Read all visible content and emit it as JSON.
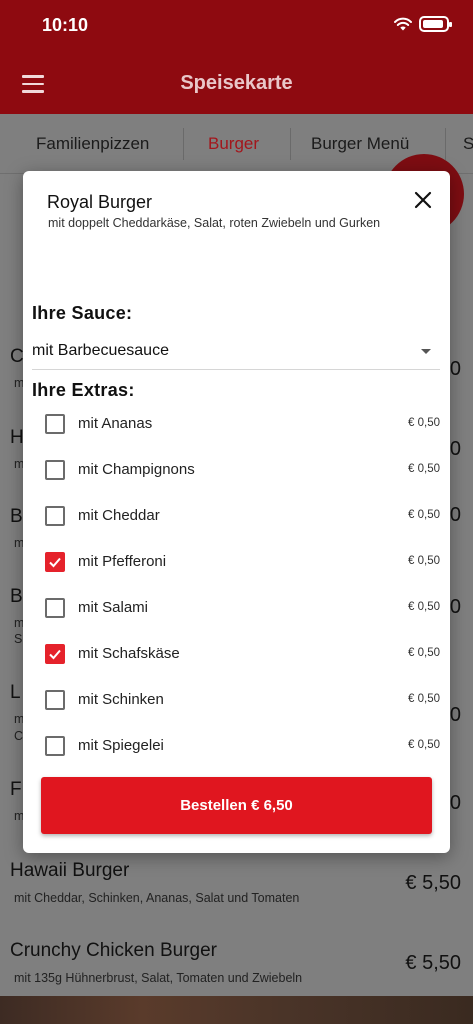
{
  "status_bar": {
    "time": "10:10"
  },
  "app_bar": {
    "title": "Speisekarte",
    "menu_icon": "hamburger-menu-icon"
  },
  "tabs": [
    {
      "label": "Familienpizzen",
      "active": false
    },
    {
      "label": "Burger",
      "active": true
    },
    {
      "label": "Burger Menü",
      "active": false
    },
    {
      "label": "S",
      "active": false
    }
  ],
  "background_list": [
    {
      "name": "C",
      "desc": "m",
      "price": "0"
    },
    {
      "name": "H",
      "desc": "m",
      "price": "0"
    },
    {
      "name": "B",
      "desc": "m",
      "price": "0"
    },
    {
      "name": "B",
      "desc": "m",
      "desc2": "S",
      "price": "0"
    },
    {
      "name": "L",
      "desc": "m",
      "desc2": "C",
      "price": "0"
    },
    {
      "name": "F",
      "desc": "m",
      "price": "0"
    },
    {
      "name": "Hawaii Burger",
      "desc": "mit Cheddar, Schinken, Ananas, Salat und Tomaten",
      "price": "€ 5,50"
    },
    {
      "name": "Crunchy Chicken Burger",
      "desc": "mit 135g Hühnerbrust, Salat, Tomaten und Zwiebeln",
      "price": "€ 5,50"
    }
  ],
  "modal": {
    "title": "Royal Burger",
    "subtitle": "mit doppelt Cheddarkäse, Salat, roten Zwiebeln und Gurken",
    "sauce_label": "Ihre Sauce:",
    "sauce_value": "mit Barbecuesauce",
    "extras_label": "Ihre Extras:",
    "extras": [
      {
        "label": "mit Ananas",
        "price": "€ 0,50",
        "checked": false
      },
      {
        "label": "mit Champignons",
        "price": "€ 0,50",
        "checked": false
      },
      {
        "label": "mit Cheddar",
        "price": "€ 0,50",
        "checked": false
      },
      {
        "label": "mit Pfefferoni",
        "price": "€ 0,50",
        "checked": true
      },
      {
        "label": "mit Salami",
        "price": "€ 0,50",
        "checked": false
      },
      {
        "label": "mit Schafskäse",
        "price": "€ 0,50",
        "checked": true
      },
      {
        "label": "mit Schinken",
        "price": "€ 0,50",
        "checked": false
      },
      {
        "label": "mit Spiegelei",
        "price": "€ 0,50",
        "checked": false
      }
    ],
    "order_button": "Bestellen € 6,50"
  },
  "colors": {
    "brand": "#8e0a10",
    "accent": "#e0161f",
    "check": "#e5222b"
  }
}
